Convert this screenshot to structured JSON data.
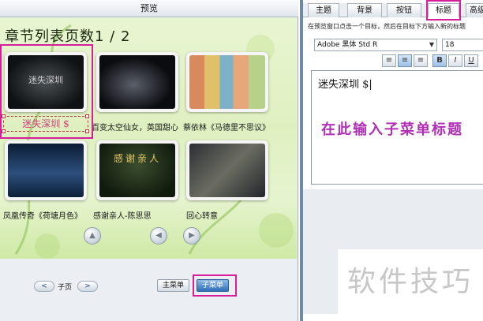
{
  "window": {
    "title": "预览"
  },
  "stage": {
    "title": "章节列表页数1 / 2"
  },
  "thumbnails": [
    {
      "overlay": "迷失深圳",
      "caption": ""
    },
    {
      "overlay": "",
      "caption": "百变太空仙女，英国甜心"
    },
    {
      "overlay": "",
      "caption": "蔡依林《马德里不思议》"
    },
    {
      "overlay": "",
      "caption": "凤凰传奇《荷塘月色》"
    },
    {
      "overlay": "感谢亲人",
      "caption": "感谢亲人-陈思思"
    },
    {
      "overlay": "",
      "caption": "回心转意"
    }
  ],
  "edit_caption": "迷失深圳 $",
  "nav": {
    "up_icon": "up-arrow-icon",
    "prev_icon": "left-arrow-icon",
    "next_icon": "right-arrow-icon"
  },
  "pager": {
    "label": "子页",
    "prev": "<",
    "next": ">"
  },
  "menu": {
    "main": "主菜单",
    "sub": "子菜单"
  },
  "panel": {
    "tabs": [
      "主题",
      "背景",
      "按钮",
      "标题",
      "高级"
    ],
    "active_tab": "标题",
    "hint": "在预览窗口点击一个目标，然后在目标下方输入新的标题",
    "font": "Adobe 黑体 Std R",
    "size": "18",
    "format_buttons": [
      "align-left-icon",
      "align-center-icon",
      "align-right-icon",
      "B",
      "I",
      "U"
    ],
    "editor_text": "迷失深圳 $|"
  },
  "annotation": "在此输入子菜单标题",
  "watermark": "软件技巧",
  "colors": {
    "highlight": "#d61f9b",
    "annotation": "#b02fb6",
    "active_button": "#2f6fb8"
  }
}
